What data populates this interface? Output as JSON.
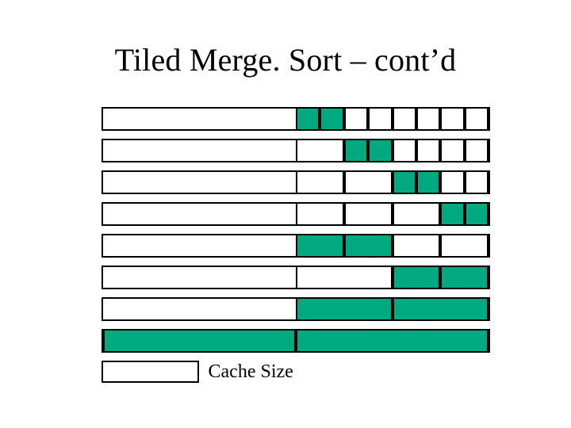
{
  "title": "Tiled Merge. Sort – cont’d",
  "cache_label": "Cache Size",
  "chart_data": {
    "type": "table",
    "title": "Tiled merge sort right-half progression",
    "total_columns": 16,
    "unit_width": 1,
    "colors": {
      "fill": "#00a97f",
      "border": "#000000"
    },
    "cache_size_units": 4,
    "rows": [
      {
        "green": [
          [
            8,
            1
          ],
          [
            9,
            1
          ]
        ],
        "dividers": [
          [
            10,
            1
          ],
          [
            11,
            1
          ],
          [
            12,
            1
          ],
          [
            13,
            1
          ],
          [
            14,
            1
          ],
          [
            15,
            1
          ]
        ],
        "center_line": false
      },
      {
        "green": [
          [
            10,
            1
          ],
          [
            11,
            1
          ]
        ],
        "dividers": [
          [
            8,
            2
          ],
          [
            12,
            1
          ],
          [
            13,
            1
          ],
          [
            14,
            1
          ],
          [
            15,
            1
          ]
        ],
        "center_line": false
      },
      {
        "green": [
          [
            12,
            1
          ],
          [
            13,
            1
          ]
        ],
        "dividers": [
          [
            8,
            2
          ],
          [
            10,
            2
          ],
          [
            14,
            1
          ],
          [
            15,
            1
          ]
        ],
        "center_line": false
      },
      {
        "green": [
          [
            14,
            1
          ],
          [
            15,
            1
          ]
        ],
        "dividers": [
          [
            8,
            2
          ],
          [
            10,
            2
          ],
          [
            12,
            2
          ]
        ],
        "center_line": false
      },
      {
        "green": [
          [
            8,
            2
          ],
          [
            10,
            2
          ]
        ],
        "dividers": [
          [
            12,
            2
          ],
          [
            14,
            2
          ]
        ],
        "center_line": false
      },
      {
        "green": [
          [
            12,
            2
          ],
          [
            14,
            2
          ]
        ],
        "dividers": [
          [
            8,
            4
          ]
        ],
        "center_line": true
      },
      {
        "green": [
          [
            8,
            4
          ],
          [
            12,
            4
          ]
        ],
        "dividers": [],
        "center_line": true
      },
      {
        "green": [
          [
            0,
            8
          ],
          [
            8,
            8
          ]
        ],
        "dividers": [],
        "center_line": true
      }
    ]
  }
}
